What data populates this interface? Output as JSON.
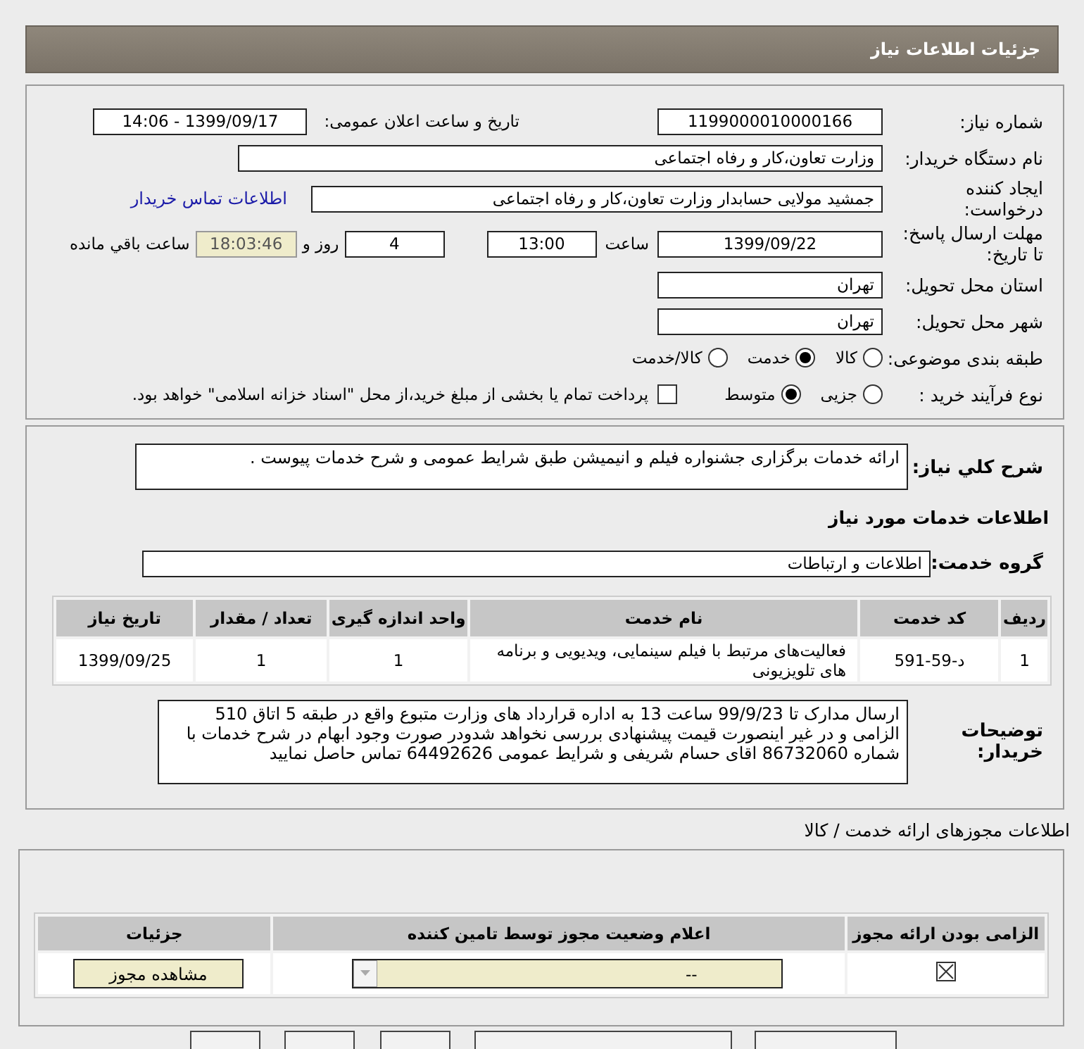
{
  "header": {
    "title": "جزئیات اطلاعات نیاز"
  },
  "need_number": {
    "label": "شماره نیاز:",
    "value": "1199000010000166"
  },
  "announce": {
    "label": "تاریخ و ساعت اعلان عمومی:",
    "value": "1399/09/17 - 14:06"
  },
  "buyer_org": {
    "label": "نام دستگاه خریدار:",
    "value": "وزارت تعاون،کار و رفاه اجتماعی"
  },
  "requester": {
    "label": "ایجاد کننده درخواست:",
    "value": "جمشید مولایی حسابدار وزارت تعاون،کار و رفاه اجتماعی",
    "link": "اطلاعات تماس خریدار"
  },
  "deadline": {
    "label": "مهلت ارسال پاسخ: تا تاریخ:",
    "date": "1399/09/22",
    "time_label": "ساعت",
    "time": "13:00",
    "days": "4",
    "days_label": "روز و",
    "remaining": "18:03:46",
    "remaining_label": "ساعت باقي مانده"
  },
  "province": {
    "label": "استان محل تحویل:",
    "value": "تهران"
  },
  "city": {
    "label": "شهر محل تحویل:",
    "value": "تهران"
  },
  "category": {
    "label": "طبقه بندی موضوعی:",
    "options": [
      {
        "label": "کالا",
        "selected": false
      },
      {
        "label": "خدمت",
        "selected": true
      },
      {
        "label": "کالا/خدمت",
        "selected": false
      }
    ]
  },
  "process": {
    "label": "نوع فرآیند خرید :",
    "options": [
      {
        "label": "جزیی",
        "selected": false
      },
      {
        "label": "متوسط",
        "selected": true
      }
    ],
    "treasury": {
      "label": "پرداخت تمام یا بخشی از مبلغ خرید،از محل \"اسناد خزانه اسلامی\" خواهد بود.",
      "checked": false
    }
  },
  "description": {
    "label": "شرح کلي نياز:",
    "value": "ارائه خدمات برگزاری جشنواره فیلم و انیمیشن طبق شرایط عمومی و شرح خدمات پیوست ."
  },
  "services_heading": "اطلاعات خدمات مورد نیاز",
  "service_group": {
    "label": "گروه خدمت:",
    "value": "اطلاعات و ارتباطات"
  },
  "table": {
    "columns": [
      "ردیف",
      "کد خدمت",
      "نام خدمت",
      "واحد اندازه گیری",
      "تعداد / مقدار",
      "تاریخ نیاز"
    ],
    "rows": [
      [
        "1",
        "د-59-591",
        "فعالیت‌های مرتبط با فیلم سینمایی، ویدیویی و برنامه های تلویزیونی",
        "1",
        "1",
        "1399/09/25"
      ]
    ]
  },
  "buyer_notes": {
    "label": "توضیحات خریدار:",
    "value": "ارسال مدارک تا 99/9/23 ساعت 13 به اداره قرارداد های وزارت متبوع واقع در طبقه 5 اتاق 510 الزامی و در غیر اینصورت قیمت پیشنهادی بررسی نخواهد شدودر صورت وجود ابهام در شرح خدمات با شماره 86732060 اقای حسام شریفی و شرایط عمومی 64492626 تماس حاصل نمایید"
  },
  "permits": {
    "title": "اطلاعات مجوزهای ارائه خدمت / کالا",
    "columns": [
      "الزامی بودن ارائه مجوز",
      "اعلام وضعیت مجوز توسط تامین کننده",
      "جزئیات"
    ],
    "rows": [
      {
        "required": true,
        "status": "--",
        "button": "مشاهده مجوز"
      }
    ]
  }
}
